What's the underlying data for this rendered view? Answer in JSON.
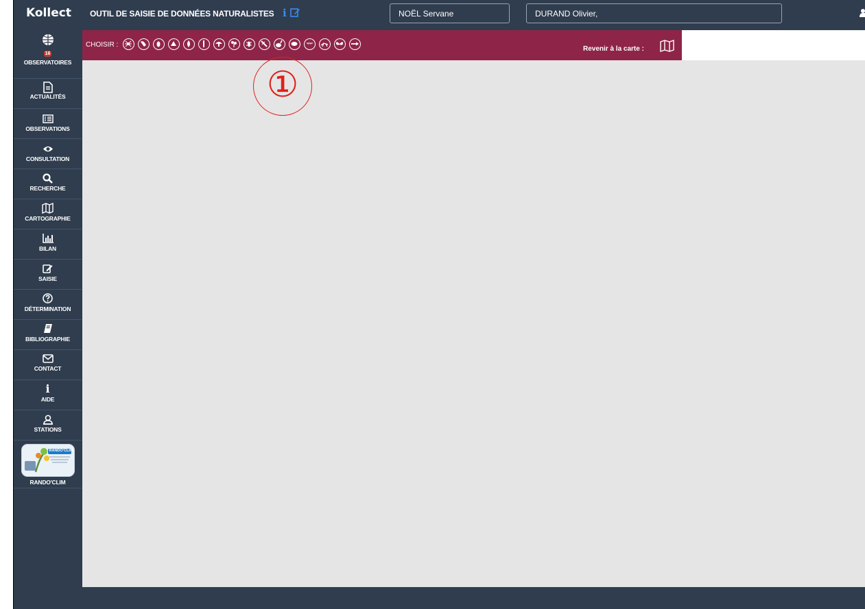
{
  "header": {
    "brand": "Kollect",
    "title": "OUTIL DE SAISIE DE DONNÉES NATURALISTES",
    "info_icon": "i",
    "edit_icon": "pencil-square-icon",
    "user_field_1": "NOËL Servane",
    "user_field_2": "DURAND Olivier,"
  },
  "sidebar": {
    "items": [
      {
        "label": "OBSERVATOIRES",
        "icon": "globe-icon",
        "badge": "16"
      },
      {
        "label": "ACTUALITÉS",
        "icon": "file-text-icon"
      },
      {
        "label": "OBSERVATIONS",
        "icon": "list-icon"
      },
      {
        "label": "CONSULTATION",
        "icon": "eye-icon"
      },
      {
        "label": "RECHERCHE",
        "icon": "search-icon"
      },
      {
        "label": "CARTOGRAPHIE",
        "icon": "map-icon"
      },
      {
        "label": "BILAN",
        "icon": "bar-chart-icon"
      },
      {
        "label": "SAISIE",
        "icon": "edit-icon"
      },
      {
        "label": "DÉTERMINATION",
        "icon": "question-icon"
      },
      {
        "label": "BIBLIOGRAPHIE",
        "icon": "book-icon"
      },
      {
        "label": "CONTACT",
        "icon": "envelope-icon"
      },
      {
        "label": "AIDE",
        "icon": "info-icon"
      },
      {
        "label": "STATIONS",
        "icon": "location-user-icon"
      },
      {
        "label": "RANDO'CLIM",
        "icon": "randoclim-logo",
        "logo_text": "RANDO'CLIM"
      }
    ]
  },
  "taxon_bar": {
    "choose_label": "CHOISIR :",
    "taxa": [
      "spider-icon",
      "mollusc-icon",
      "beetle-icon",
      "bee-icon",
      "plant-icon",
      "amphibian-icon",
      "mushroom-icon",
      "flower-icon",
      "insect-icon",
      "dragonfly-icon",
      "rabbit-icon",
      "fish-icon",
      "bird-icon",
      "grasshopper-icon",
      "butterfly-icon",
      "eel-icon"
    ],
    "back_label": "Revenir à la carte :",
    "back_icon": "map-icon"
  },
  "annotation": {
    "number": "①"
  },
  "colors": {
    "navy": "#2f3d4e",
    "crimson": "#8e2548",
    "content": "#e5e5e5",
    "accent_blue": "#3a8df5",
    "annotation_red": "#e0201c"
  }
}
